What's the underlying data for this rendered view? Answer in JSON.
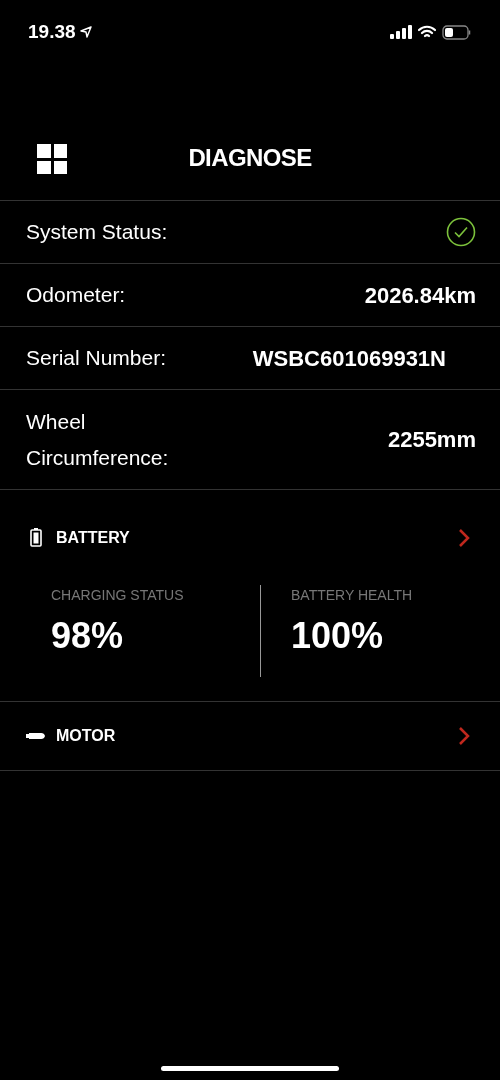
{
  "status_bar": {
    "time": "19.38"
  },
  "header": {
    "title": "DIAGNOSE"
  },
  "info_rows": [
    {
      "kind": "status",
      "label": "System Status:",
      "ok": true
    },
    {
      "kind": "text",
      "label": "Odometer:",
      "value": "2026.84km"
    },
    {
      "kind": "text",
      "label": "Serial Number:",
      "value": "WSBC601069931N"
    },
    {
      "kind": "text",
      "label": "Wheel Circumference:",
      "value": "2255mm"
    }
  ],
  "sections": [
    {
      "kind": "battery",
      "title": "BATTERY",
      "stats": [
        {
          "label": "CHARGING STATUS",
          "value": "98%"
        },
        {
          "label": "BATTERY HEALTH",
          "value": "100%"
        }
      ]
    },
    {
      "kind": "motor",
      "title": "MOTOR"
    }
  ]
}
